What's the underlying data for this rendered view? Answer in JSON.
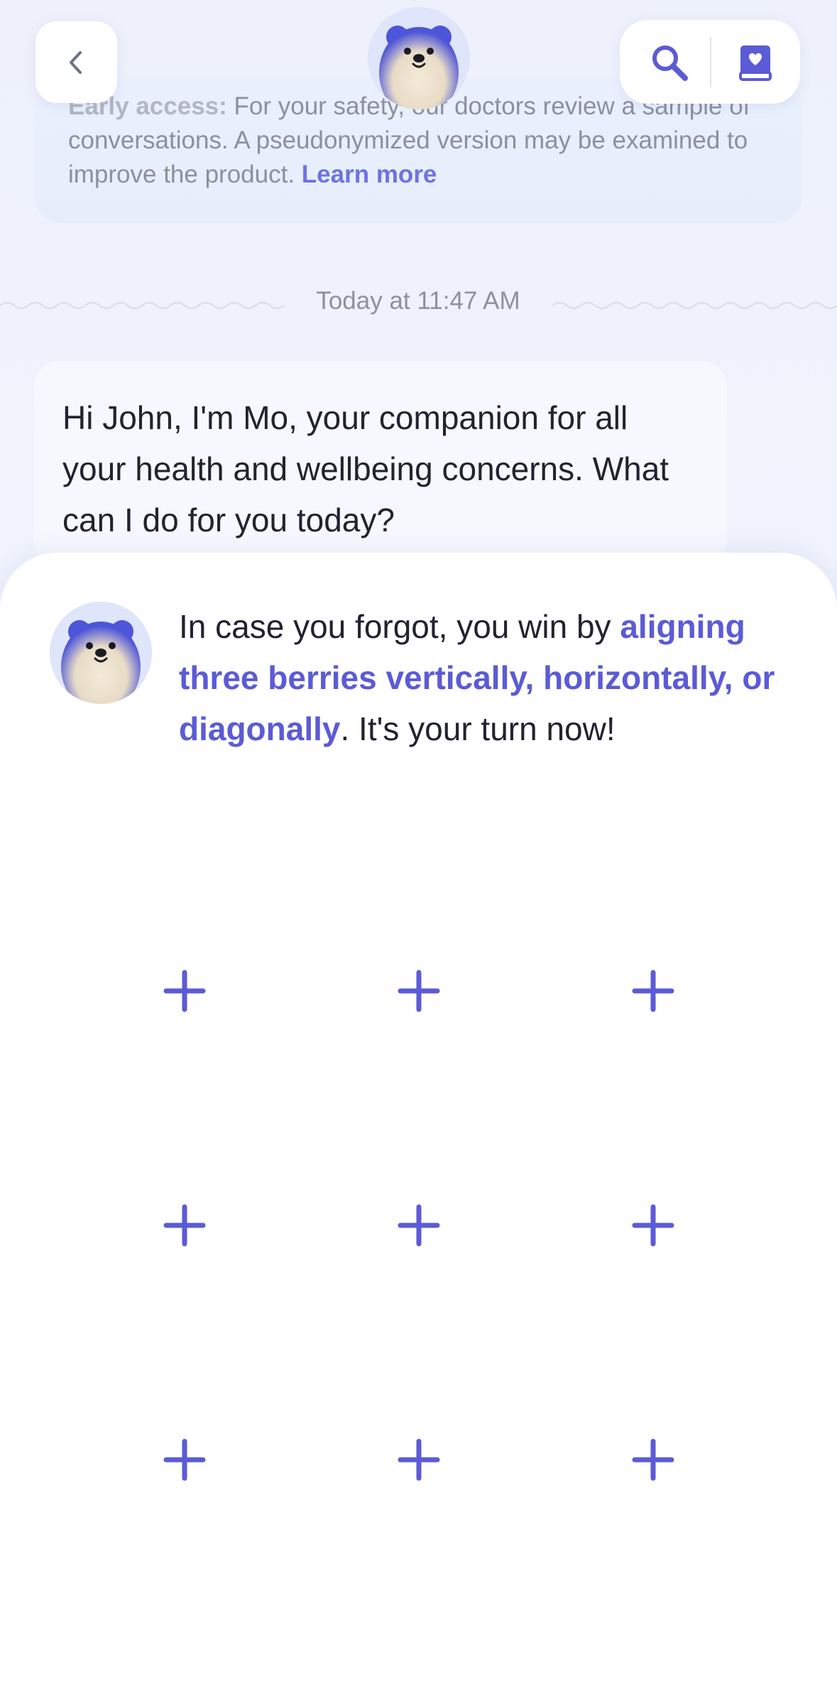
{
  "notice": {
    "label": "Early access:",
    "text": " For your safety, our doctors review a sample of conversations. A pseudonymized version may be examined to improve the product. ",
    "link": "Learn more"
  },
  "chat": {
    "date": "Today at 11:47 AM",
    "greeting": "Hi John, I'm Mo, your companion for all your health and wellbeing concerns. What can I do for you today?"
  },
  "game": {
    "hint_before": "In case you forgot, you win by ",
    "hint_highlight": "aligning three berries vertically, horizontally, or diagonally",
    "hint_after": ". It's your turn now!",
    "cells": [
      "",
      "",
      "",
      "",
      "",
      "",
      "",
      "",
      ""
    ]
  },
  "icons": {
    "back": "chevron-left-icon",
    "search": "search-icon",
    "journal": "journal-heart-icon",
    "cell": "plus-icon"
  },
  "colors": {
    "accent": "#5b5bd6",
    "background": "#eef2fc",
    "sheet": "#ffffff"
  }
}
